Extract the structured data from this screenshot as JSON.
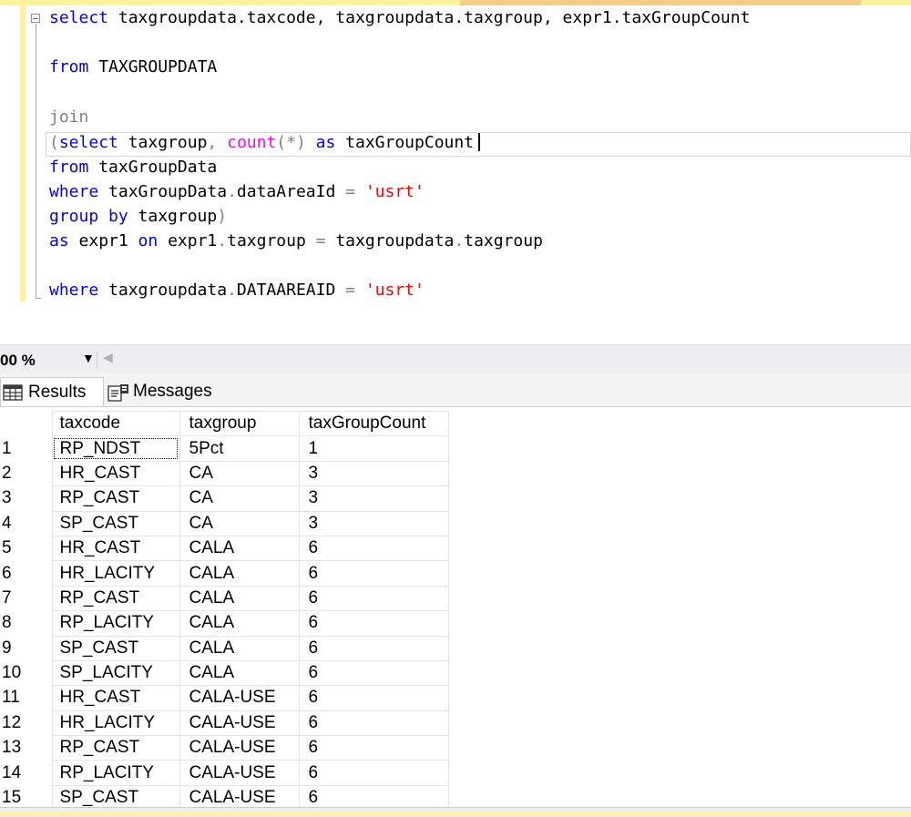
{
  "editor": {
    "lines": [
      {
        "id": "l1",
        "segments": [
          [
            "kw",
            "select"
          ],
          [
            "",
            "taxgroupdata.taxcode, taxgroupdata.taxgroup, expr1.taxGroupCount"
          ]
        ]
      },
      {
        "id": "l2",
        "segments": [
          [
            "kw",
            "from"
          ],
          [
            "",
            " TAXGROUPDATA"
          ]
        ]
      },
      {
        "id": "l3",
        "segments": [
          [
            "cmt",
            "join"
          ]
        ]
      },
      {
        "id": "l4",
        "segments": [
          [
            "gray",
            "("
          ],
          [
            "kw",
            "select"
          ],
          [
            "",
            " taxgroup"
          ],
          [
            "gray",
            ", "
          ],
          [
            "fn",
            "count"
          ],
          [
            "gray",
            "(*)"
          ],
          [
            "kw",
            " as"
          ],
          [
            "",
            " taxGroupCount"
          ]
        ]
      },
      {
        "id": "l5",
        "segments": [
          [
            "kw",
            "from"
          ],
          [
            "",
            " taxGroupData"
          ]
        ]
      },
      {
        "id": "l6",
        "segments": [
          [
            "kw",
            "where"
          ],
          [
            "",
            " taxGroupData"
          ],
          [
            "gray",
            "."
          ],
          [
            "",
            "dataAreaId "
          ],
          [
            "gray",
            "= "
          ],
          [
            "str",
            "'usrt'"
          ]
        ]
      },
      {
        "id": "l7",
        "segments": [
          [
            "kw",
            "group by"
          ],
          [
            "",
            " taxgroup"
          ],
          [
            "gray",
            ")"
          ]
        ]
      },
      {
        "id": "l8",
        "segments": [
          [
            "kw",
            "as"
          ],
          [
            "",
            " expr1 "
          ],
          [
            "kw",
            "on"
          ],
          [
            "",
            " expr1"
          ],
          [
            "gray",
            "."
          ],
          [
            "",
            "taxgroup "
          ],
          [
            "gray",
            "= "
          ],
          [
            "",
            "taxgroupdata"
          ],
          [
            "gray",
            "."
          ],
          [
            "",
            "taxgroup"
          ]
        ]
      },
      {
        "id": "l9",
        "segments": [
          [
            "kw",
            "where"
          ],
          [
            "",
            " taxgroupdata"
          ],
          [
            "gray",
            "."
          ],
          [
            "",
            "DATAAREAID "
          ],
          [
            "gray",
            "= "
          ],
          [
            "str",
            "'usrt'"
          ]
        ]
      }
    ]
  },
  "zoom": {
    "value": "00 %"
  },
  "tabs": {
    "results": "Results",
    "messages": "Messages"
  },
  "grid": {
    "columns": [
      "taxcode",
      "taxgroup",
      "taxGroupCount"
    ],
    "rows": [
      [
        "1",
        "RP_NDST",
        "5Pct",
        "1"
      ],
      [
        "2",
        "HR_CAST",
        "CA",
        "3"
      ],
      [
        "3",
        "RP_CAST",
        "CA",
        "3"
      ],
      [
        "4",
        "SP_CAST",
        "CA",
        "3"
      ],
      [
        "5",
        "HR_CAST",
        "CALA",
        "6"
      ],
      [
        "6",
        "HR_LACITY",
        "CALA",
        "6"
      ],
      [
        "7",
        "RP_CAST",
        "CALA",
        "6"
      ],
      [
        "8",
        "RP_LACITY",
        "CALA",
        "6"
      ],
      [
        "9",
        "SP_CAST",
        "CALA",
        "6"
      ],
      [
        "10",
        "SP_LACITY",
        "CALA",
        "6"
      ],
      [
        "11",
        "HR_CAST",
        "CALA-USE",
        "6"
      ],
      [
        "12",
        "HR_LACITY",
        "CALA-USE",
        "6"
      ],
      [
        "13",
        "RP_CAST",
        "CALA-USE",
        "6"
      ],
      [
        "14",
        "RP_LACITY",
        "CALA-USE",
        "6"
      ],
      [
        "15",
        "SP_CAST",
        "CALA-USE",
        "6"
      ]
    ]
  },
  "icons": {
    "fold": "collapse-icon",
    "results": "grid-icon",
    "messages": "messages-icon"
  }
}
